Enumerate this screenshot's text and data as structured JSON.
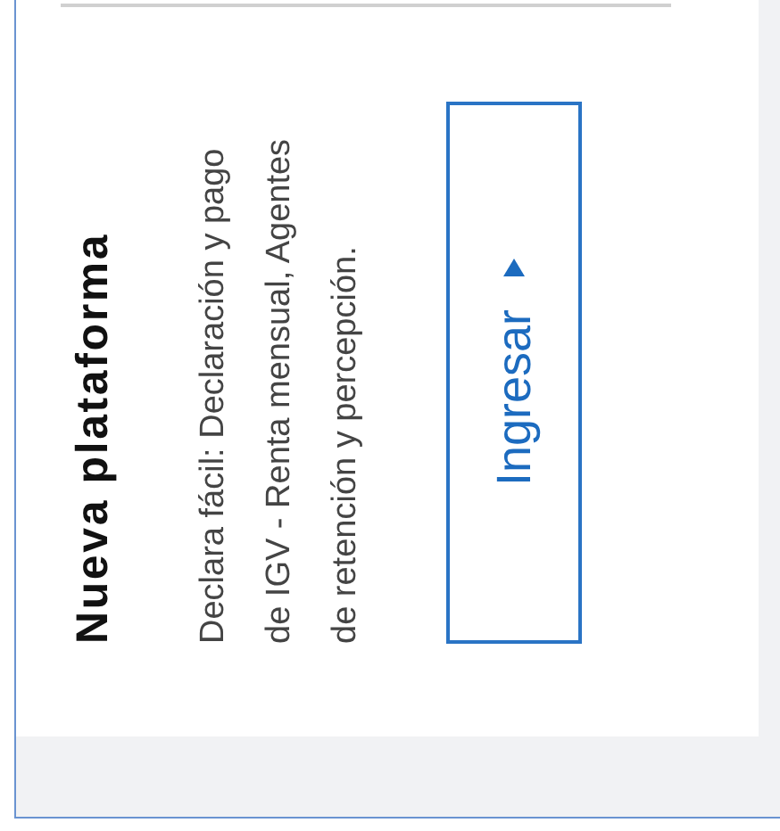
{
  "card": {
    "title": "Nueva plataforma",
    "description": "Declara fácil: Declaración y pago de IGV - Renta mensual, Agentes de retención y percepción.",
    "button": {
      "label": "Ingresar"
    }
  }
}
